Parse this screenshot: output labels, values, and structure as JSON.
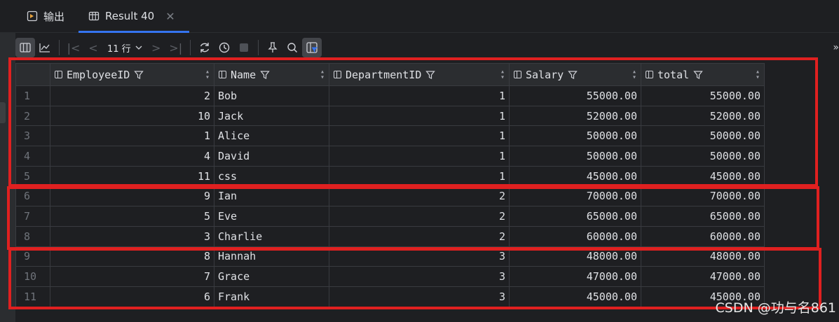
{
  "tabs": [
    {
      "label": "输出",
      "icon": "output-console-icon"
    },
    {
      "label": "Result 40",
      "icon": "table-grid-icon",
      "close": "✕"
    }
  ],
  "toolbar": {
    "row_count_label": "11 行",
    "icons": [
      "table-view-icon",
      "chart-view-icon",
      "first-page-icon",
      "prev-page-icon",
      "next-page-icon",
      "last-page-icon",
      "refresh-icon",
      "history-icon",
      "stop-icon",
      "pin-icon",
      "search-icon",
      "filter-panel-icon"
    ],
    "overflow_label": "»"
  },
  "table": {
    "columns": [
      {
        "name": "EmployeeID",
        "key": "employee_id"
      },
      {
        "name": "Name",
        "key": "name"
      },
      {
        "name": "DepartmentID",
        "key": "department_id"
      },
      {
        "name": "Salary",
        "key": "salary"
      },
      {
        "name": "total",
        "key": "total"
      }
    ],
    "rows": [
      {
        "n": "1",
        "employee_id": "2",
        "name": "Bob",
        "department_id": "1",
        "salary": "55000.00",
        "total": "55000.00"
      },
      {
        "n": "2",
        "employee_id": "10",
        "name": "Jack",
        "department_id": "1",
        "salary": "52000.00",
        "total": "52000.00"
      },
      {
        "n": "3",
        "employee_id": "1",
        "name": "Alice",
        "department_id": "1",
        "salary": "50000.00",
        "total": "50000.00"
      },
      {
        "n": "4",
        "employee_id": "4",
        "name": "David",
        "department_id": "1",
        "salary": "50000.00",
        "total": "50000.00"
      },
      {
        "n": "5",
        "employee_id": "11",
        "name": "css",
        "department_id": "1",
        "salary": "45000.00",
        "total": "45000.00"
      },
      {
        "n": "6",
        "employee_id": "9",
        "name": "Ian",
        "department_id": "2",
        "salary": "70000.00",
        "total": "70000.00"
      },
      {
        "n": "7",
        "employee_id": "5",
        "name": "Eve",
        "department_id": "2",
        "salary": "65000.00",
        "total": "65000.00"
      },
      {
        "n": "8",
        "employee_id": "3",
        "name": "Charlie",
        "department_id": "2",
        "salary": "60000.00",
        "total": "60000.00"
      },
      {
        "n": "9",
        "employee_id": "8",
        "name": "Hannah",
        "department_id": "3",
        "salary": "48000.00",
        "total": "48000.00"
      },
      {
        "n": "10",
        "employee_id": "7",
        "name": "Grace",
        "department_id": "3",
        "salary": "47000.00",
        "total": "47000.00"
      },
      {
        "n": "11",
        "employee_id": "6",
        "name": "Frank",
        "department_id": "3",
        "salary": "45000.00",
        "total": "45000.00"
      }
    ]
  },
  "annotation_color": "#e02020",
  "watermark": "CSDN @功与名861"
}
